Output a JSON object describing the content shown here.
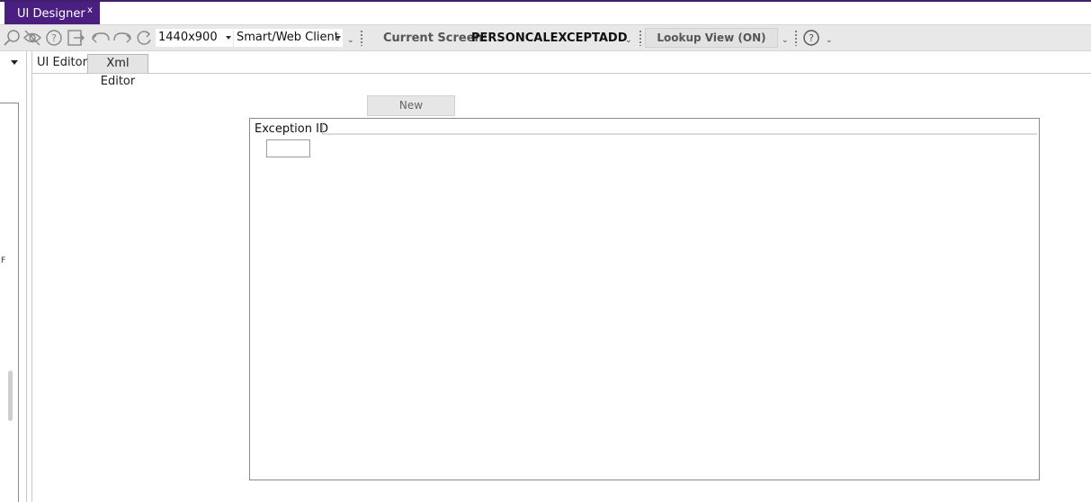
{
  "window": {
    "tab_title": "UI Designer",
    "tab_close": "x"
  },
  "toolbar": {
    "icons": [
      "search-icon",
      "hide-icon",
      "help-icon",
      "exit-icon",
      "undo-icon",
      "redo-icon",
      "refresh-icon"
    ],
    "resolution": "1440x900",
    "client": "Smart/Web Client",
    "current_screen_label": "Current Screen:",
    "current_screen_value": "PERSONCALEXCEPTADD",
    "lookup_view": "Lookup View (ON)",
    "overflow_glyph": "⌄",
    "help_icon": "help-circle-icon"
  },
  "left_panel": {
    "glyph": "F"
  },
  "editor_tabs": {
    "ui_editor": "UI Editor",
    "xml_editor": "Xml Editor"
  },
  "canvas": {
    "new_button": "New",
    "grid": {
      "columns": [
        "Exception ID"
      ]
    }
  },
  "colors": {
    "accent": "#4b1f82",
    "toolbar_bg": "#e8e8e8"
  }
}
